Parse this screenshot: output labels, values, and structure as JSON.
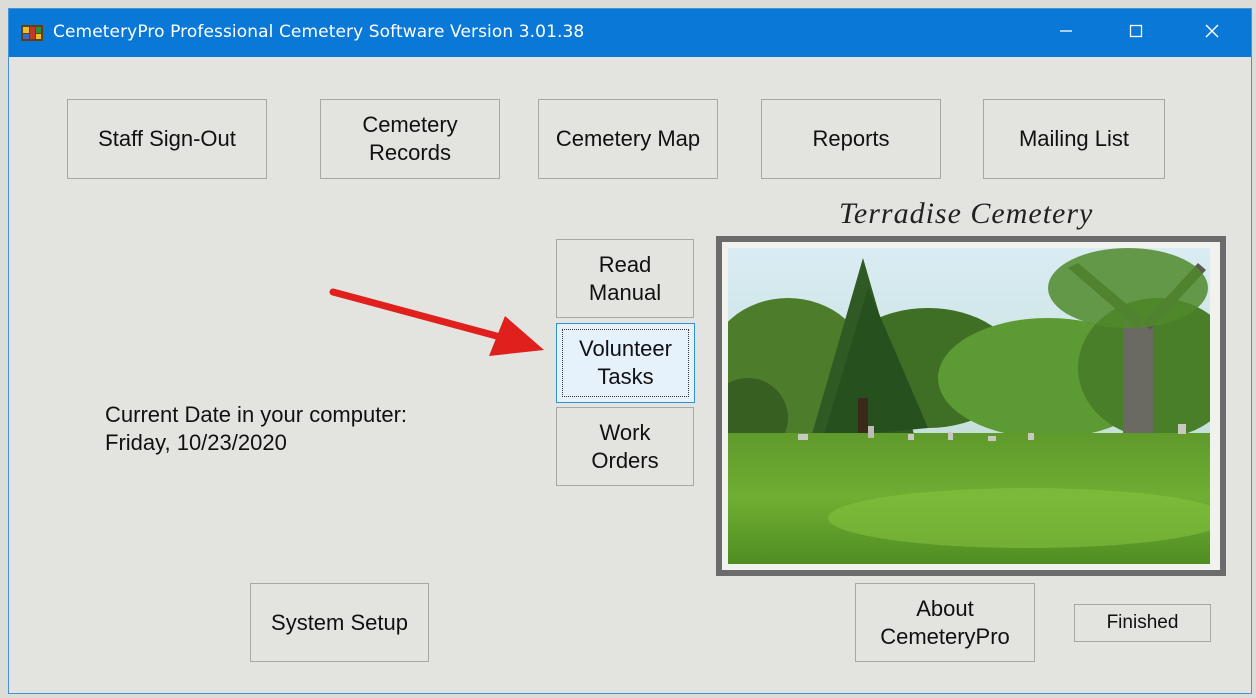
{
  "window": {
    "title": "CemeteryPro Professional Cemetery Software Version 3.01.38",
    "controls": {
      "minimize": "—",
      "maximize": "☐",
      "close": "✕"
    }
  },
  "top_buttons": {
    "staff_sign_out": "Staff Sign-Out",
    "cemetery_records": "Cemetery\nRecords",
    "cemetery_map": "Cemetery Map",
    "reports": "Reports",
    "mailing_list": "Mailing List"
  },
  "middle_buttons": {
    "read_manual": "Read\nManual",
    "volunteer_tasks": "Volunteer\nTasks",
    "work_orders": "Work\nOrders"
  },
  "date_info": {
    "label": "Current Date in your computer:",
    "value": "Friday, 10/23/2020"
  },
  "cemetery_name": "Terradise Cemetery",
  "bottom_buttons": {
    "system_setup": "System Setup",
    "about": "About\nCemeteryPro",
    "finished": "Finished"
  },
  "icons": {
    "app": "cemetery-app-icon",
    "annotation": "red-arrow-icon"
  },
  "colors": {
    "titlebar": "#0a78d7",
    "window_bg": "#e3e3e0",
    "focus_border": "#2f8fd8",
    "arrow": "#e0201c"
  }
}
